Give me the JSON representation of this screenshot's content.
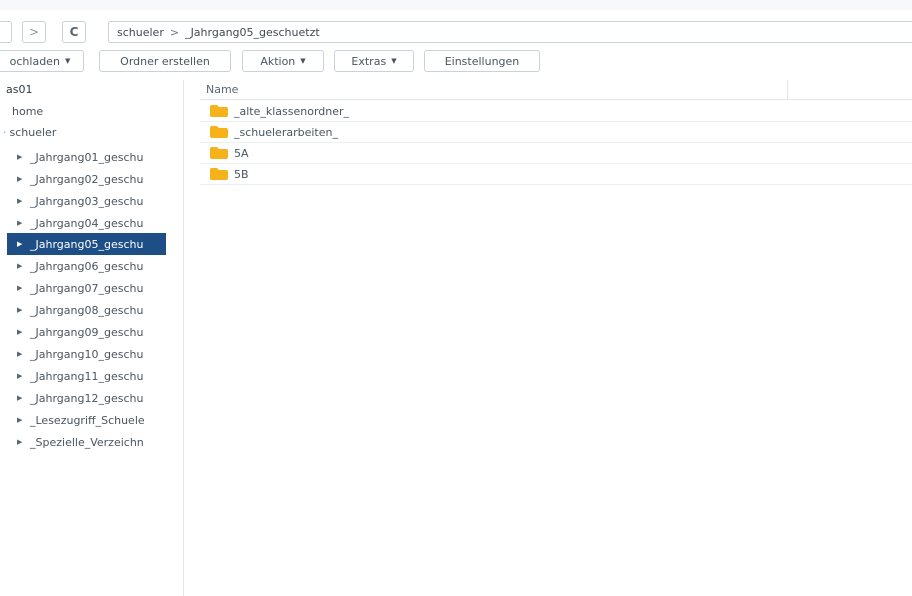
{
  "nav": {
    "back_icon": "back-icon",
    "forward_glyph": ">",
    "refresh_glyph": "C",
    "path": [
      "schueler",
      "_Jahrgang05_geschuetzt"
    ],
    "path_sep": ">"
  },
  "toolbar": {
    "upload_label": "ochladen",
    "create_folder_label": "Ordner erstellen",
    "action_label": "Aktion",
    "extras_label": "Extras",
    "settings_label": "Einstellungen"
  },
  "sidebar": {
    "root_label": "as01",
    "home_label": "home",
    "schueler_label": "schueler",
    "items": [
      {
        "label": "_Jahrgang01_geschu"
      },
      {
        "label": "_Jahrgang02_geschu"
      },
      {
        "label": "_Jahrgang03_geschu"
      },
      {
        "label": "_Jahrgang04_geschu"
      },
      {
        "label": "_Jahrgang05_geschu"
      },
      {
        "label": "_Jahrgang06_geschu"
      },
      {
        "label": "_Jahrgang07_geschu"
      },
      {
        "label": "_Jahrgang08_geschu"
      },
      {
        "label": "_Jahrgang09_geschu"
      },
      {
        "label": "_Jahrgang10_geschu"
      },
      {
        "label": "_Jahrgang11_geschu"
      },
      {
        "label": "_Jahrgang12_geschu"
      },
      {
        "label": "_Lesezugriff_Schuele"
      },
      {
        "label": "_Spezielle_Verzeichn"
      }
    ]
  },
  "filelist": {
    "column_name": "Name",
    "rows": [
      {
        "name": "_alte_klassenordner_"
      },
      {
        "name": "_schuelerarbeiten_"
      },
      {
        "name": "5A"
      },
      {
        "name": "5B"
      }
    ]
  },
  "colors": {
    "selected_bg": "#1d4f86",
    "folder": "#f5b21b"
  }
}
